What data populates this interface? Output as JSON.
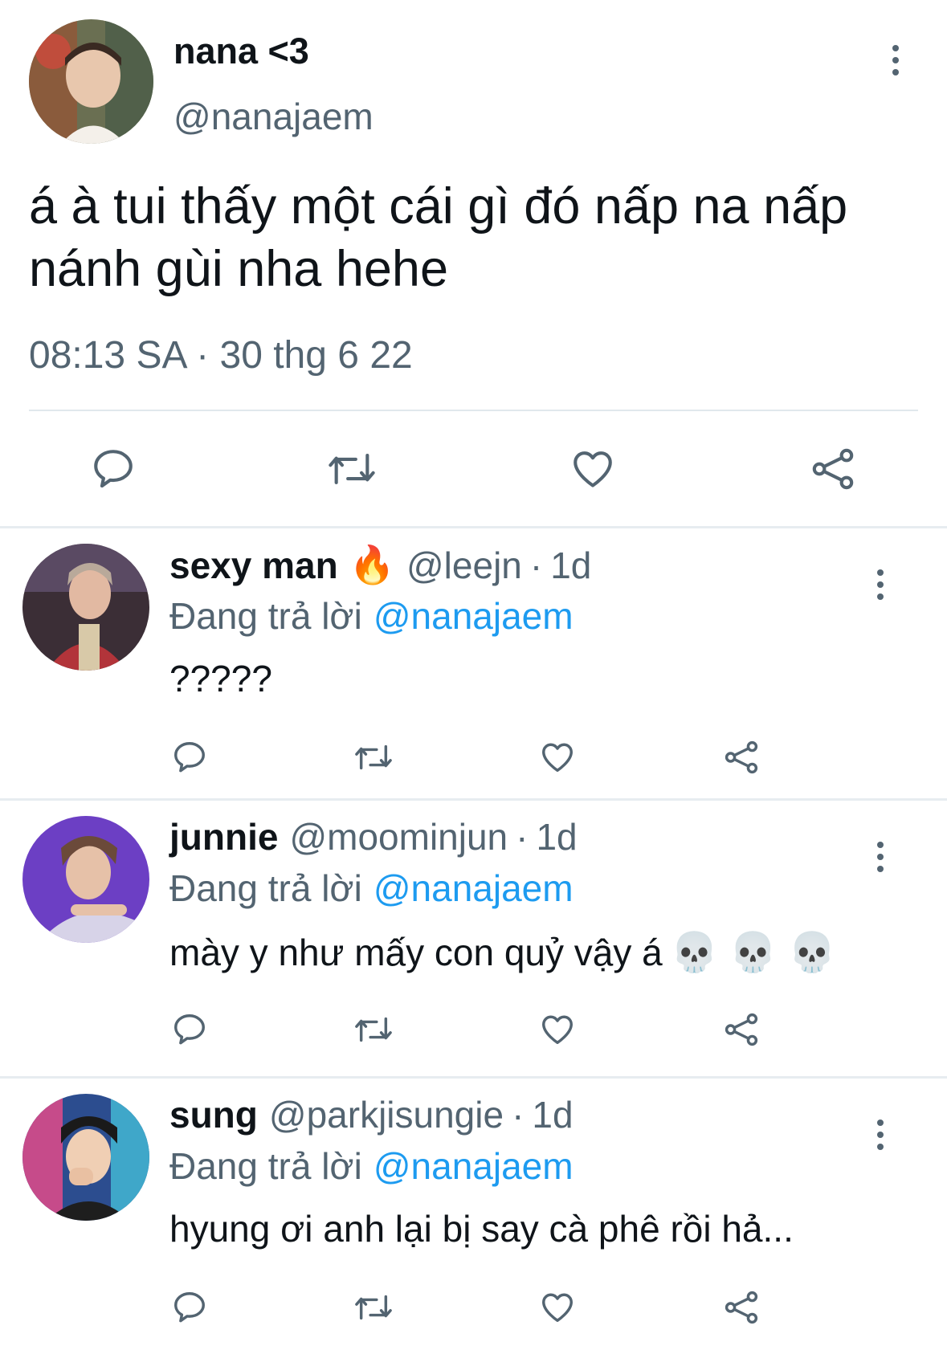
{
  "main_tweet": {
    "display_name": "nana <3",
    "handle": "@nanajaem",
    "text": "á à tui thấy một cái gì đó nấp na nấp\nnánh gùi nha hehe",
    "timestamp": "08:13 SA · 30 thg 6 22"
  },
  "replies": [
    {
      "display_name": "sexy man",
      "emoji": "🔥",
      "handle": "@leejn",
      "dot": "·",
      "age": "1d",
      "replying_label": "Đang trả lời",
      "replying_handle": "@nanajaem",
      "text": "?????"
    },
    {
      "display_name": "junnie",
      "handle": "@moominjun",
      "dot": "·",
      "age": "1d",
      "replying_label": "Đang trả lời",
      "replying_handle": "@nanajaem",
      "text": "mày y như mấy con quỷ vậy á",
      "emojis": "💀 💀 💀"
    },
    {
      "display_name": "sung",
      "handle": "@parkjisungie",
      "dot": "·",
      "age": "1d",
      "replying_label": "Đang trả lời",
      "replying_handle": "@nanajaem",
      "text": "hyung ơi anh lại bị say cà phê rồi hả..."
    }
  ],
  "icons": {
    "reply": "reply-icon",
    "retweet": "retweet-icon",
    "like": "heart-icon",
    "share": "share-icon",
    "more": "more-vertical-icon"
  },
  "colors": {
    "text_primary": "#0f1419",
    "text_secondary": "#536471",
    "link": "#1d9bf0",
    "divider": "#e1e8ed"
  }
}
